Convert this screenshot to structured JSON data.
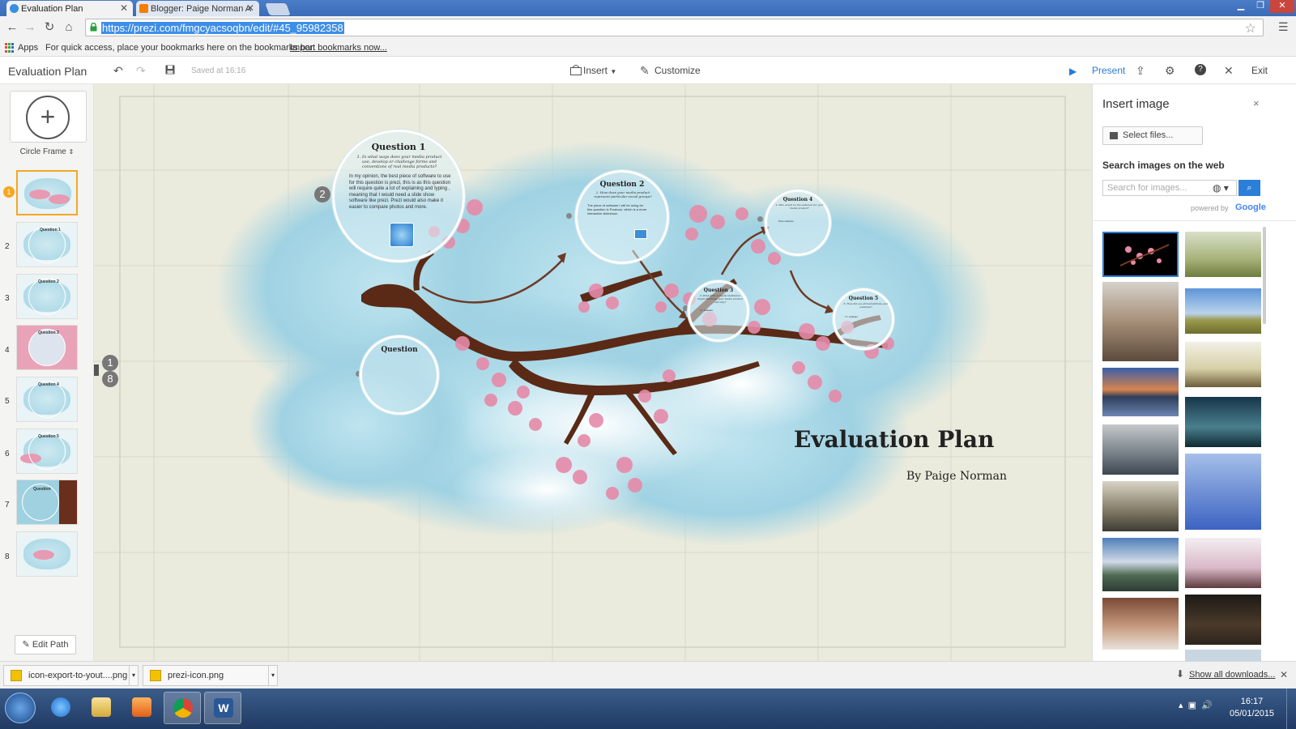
{
  "browser": {
    "tabs": [
      {
        "label": "Evaluation Plan",
        "active": true
      },
      {
        "label": "Blogger: Paige Norman A",
        "active": false
      }
    ],
    "url": "https://prezi.com/fmgcyacsoqbn/edit/#45_95982358",
    "bookmarks": {
      "apps_label": "Apps",
      "hint": "For quick access, place your bookmarks here on the bookmarks bar.",
      "import_link": "Import bookmarks now..."
    }
  },
  "toolbar": {
    "title": "Evaluation Plan",
    "saved": "Saved at 16:16",
    "insert_label": "Insert",
    "customize_label": "Customize",
    "present_label": "Present",
    "exit_label": "Exit"
  },
  "sidebar": {
    "frame_type_label": "Circle Frame",
    "selected_badge": "1",
    "thumbnail_numbers": [
      "1",
      "2",
      "3",
      "4",
      "5",
      "6",
      "7",
      "8"
    ],
    "thumbnail_labels": [
      "Question 1",
      "Question 2",
      "Question 3",
      "Question 4",
      "Question 5",
      "Question"
    ],
    "edit_path_label": "Edit Path"
  },
  "canvas": {
    "title": "Evaluation Plan",
    "byline": "By Paige Norman",
    "path_numbers": [
      "2",
      "1",
      "8"
    ],
    "questions": {
      "q1": {
        "title": "Question 1",
        "sub": "1. In what ways does your media product use, develop or challenge forms and conventions of real media products?",
        "body": "In my opinion, the best piece of software to use for this question is prezi, this is as this question will require quite a lot of explaining and typing , meaning that I would need a slide show software like prezi. Prezi would also make it easier to compare photos and more."
      },
      "q2": {
        "title": "Question 2",
        "sub": "2. How does your media product represent particular social groups?",
        "body": "The piece of software I will be using for this question is Powtoon, which is a more interactive slideshow."
      },
      "q3": {
        "title": "Question 3",
        "sub": "3. What kind of media institution might distribute your media product and why?",
        "body": "I.T. software"
      },
      "q4": {
        "title": "Question 4",
        "sub": "4. Who would be the audience for your media product?",
        "body": "Pixie software"
      },
      "q5": {
        "title": "Question 5",
        "sub": "5. How did you attract/address your audience?",
        "body": "I.T. software"
      },
      "q6": {
        "title": "Question"
      }
    }
  },
  "insert_panel": {
    "title": "Insert image",
    "close": "×",
    "select_files": "Select files...",
    "search_label": "Search images on the web",
    "search_placeholder": "Search for images...",
    "powered_by": "powered by",
    "google": "Google"
  },
  "downloads": {
    "items": [
      "icon-export-to-yout....png",
      "prezi-icon.png"
    ],
    "show_all": "Show all downloads..."
  },
  "taskbar": {
    "time": "16:17",
    "date": "05/01/2015"
  },
  "colors": {
    "accent": "#2b7fd8",
    "selection": "#f5a623",
    "canvas_bg": "#ebebdd",
    "cloud": "#a7d7e6",
    "blossom": "#e58aa8",
    "branch": "#5a2a16"
  }
}
